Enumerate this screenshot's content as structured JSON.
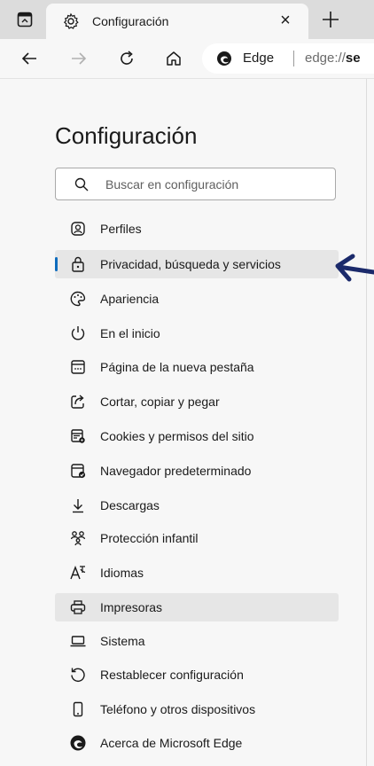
{
  "tab": {
    "title": "Configuración",
    "close_glyph": "×",
    "new_tab_glyph": "+"
  },
  "address": {
    "brand": "Edge",
    "url_scheme": "edge://",
    "url_rest": "se"
  },
  "page": {
    "title": "Configuración"
  },
  "search": {
    "placeholder": "Buscar en configuración"
  },
  "nav": {
    "items": [
      {
        "label": "Perfiles",
        "icon": "profiles-icon"
      },
      {
        "label": "Privacidad, búsqueda y servicios",
        "icon": "lock-icon",
        "selected": true
      },
      {
        "label": "Apariencia",
        "icon": "palette-icon"
      },
      {
        "label": "En el inicio",
        "icon": "power-icon"
      },
      {
        "label": "Página de la nueva pestaña",
        "icon": "new-tab-page-icon"
      },
      {
        "label": "Cortar, copiar y pegar",
        "icon": "share-icon"
      },
      {
        "label": "Cookies y permisos del sitio",
        "icon": "cookies-icon"
      },
      {
        "label": "Navegador predeterminado",
        "icon": "default-browser-icon"
      },
      {
        "label": "Descargas",
        "icon": "download-icon"
      },
      {
        "label": "Protección infantil",
        "icon": "family-icon"
      },
      {
        "label": "Idiomas",
        "icon": "languages-icon"
      },
      {
        "label": "Impresoras",
        "icon": "printer-icon",
        "hovered": true
      },
      {
        "label": "Sistema",
        "icon": "laptop-icon"
      },
      {
        "label": "Restablecer configuración",
        "icon": "reset-icon"
      },
      {
        "label": "Teléfono y otros dispositivos",
        "icon": "phone-icon"
      },
      {
        "label": "Acerca de Microsoft Edge",
        "icon": "edge-logo-icon"
      }
    ]
  },
  "colors": {
    "accent": "#0f6cbd",
    "annotation_arrow": "#1b2a6b",
    "selected_bg": "#e6e6e6"
  }
}
